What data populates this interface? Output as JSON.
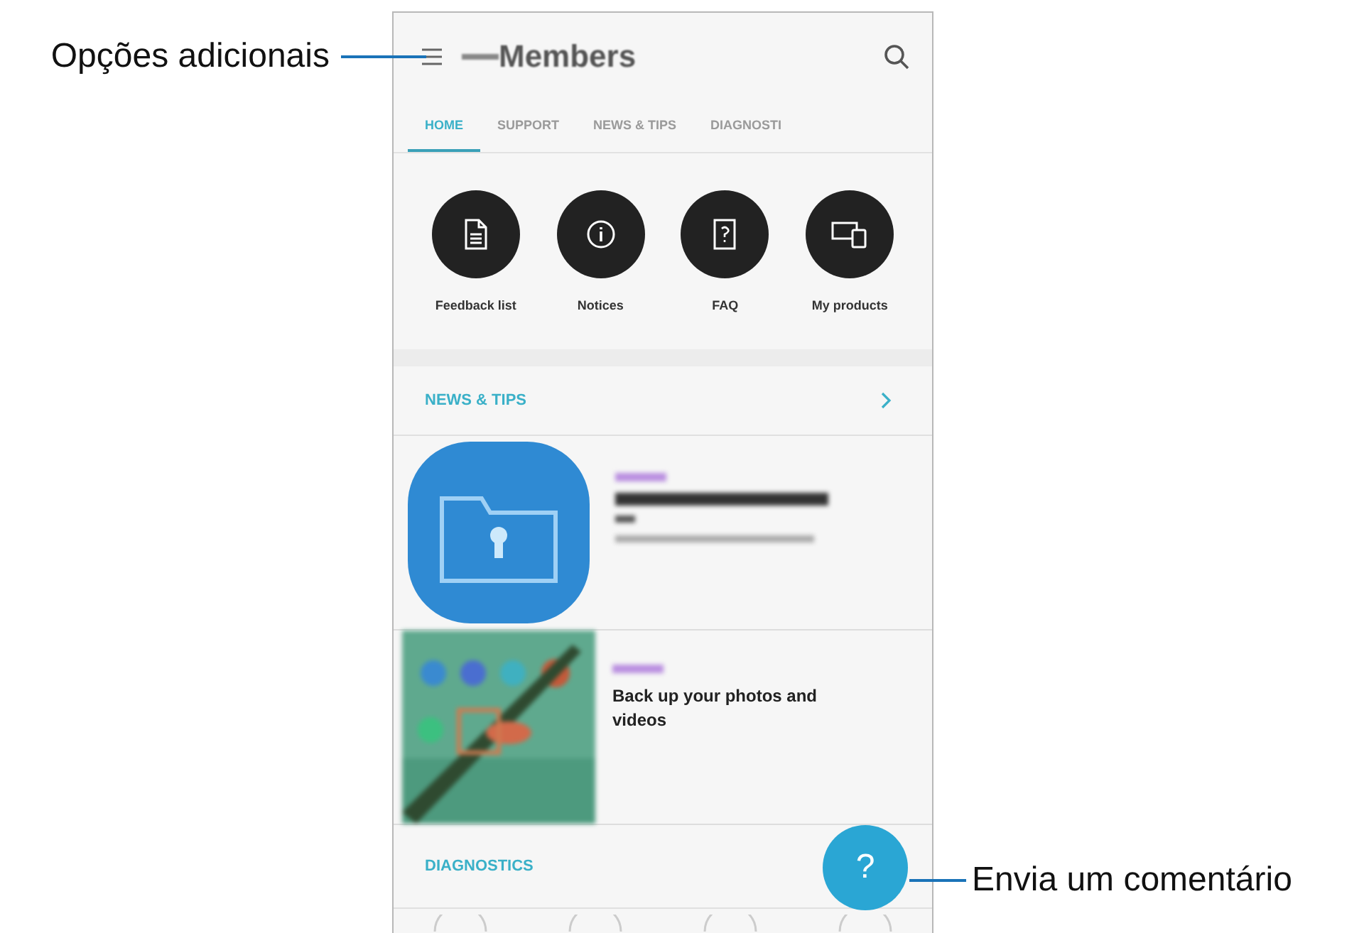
{
  "callout_left": "Opções adicionais",
  "callout_right": "Envia um comentário",
  "app": {
    "title": "Members",
    "tabs": [
      {
        "label": "HOME",
        "selected": true
      },
      {
        "label": "SUPPORT",
        "selected": false
      },
      {
        "label": "NEWS & TIPS",
        "selected": false
      },
      {
        "label": "DIAGNOSTI",
        "selected": false
      }
    ],
    "shortcuts": [
      {
        "kind": "document",
        "label": "Feedback list"
      },
      {
        "kind": "info",
        "label": "Notices"
      },
      {
        "kind": "faq",
        "label": "FAQ"
      },
      {
        "kind": "devices",
        "label": "My products"
      }
    ],
    "news_section": {
      "title": "NEWS & TIPS"
    },
    "cards": [
      {
        "kind": "app-icon"
      },
      {
        "kind": "picture",
        "title": "Back up your photos and videos"
      }
    ],
    "diagnostics_section": {
      "title": "DIAGNOSTICS"
    },
    "fab": "?"
  }
}
